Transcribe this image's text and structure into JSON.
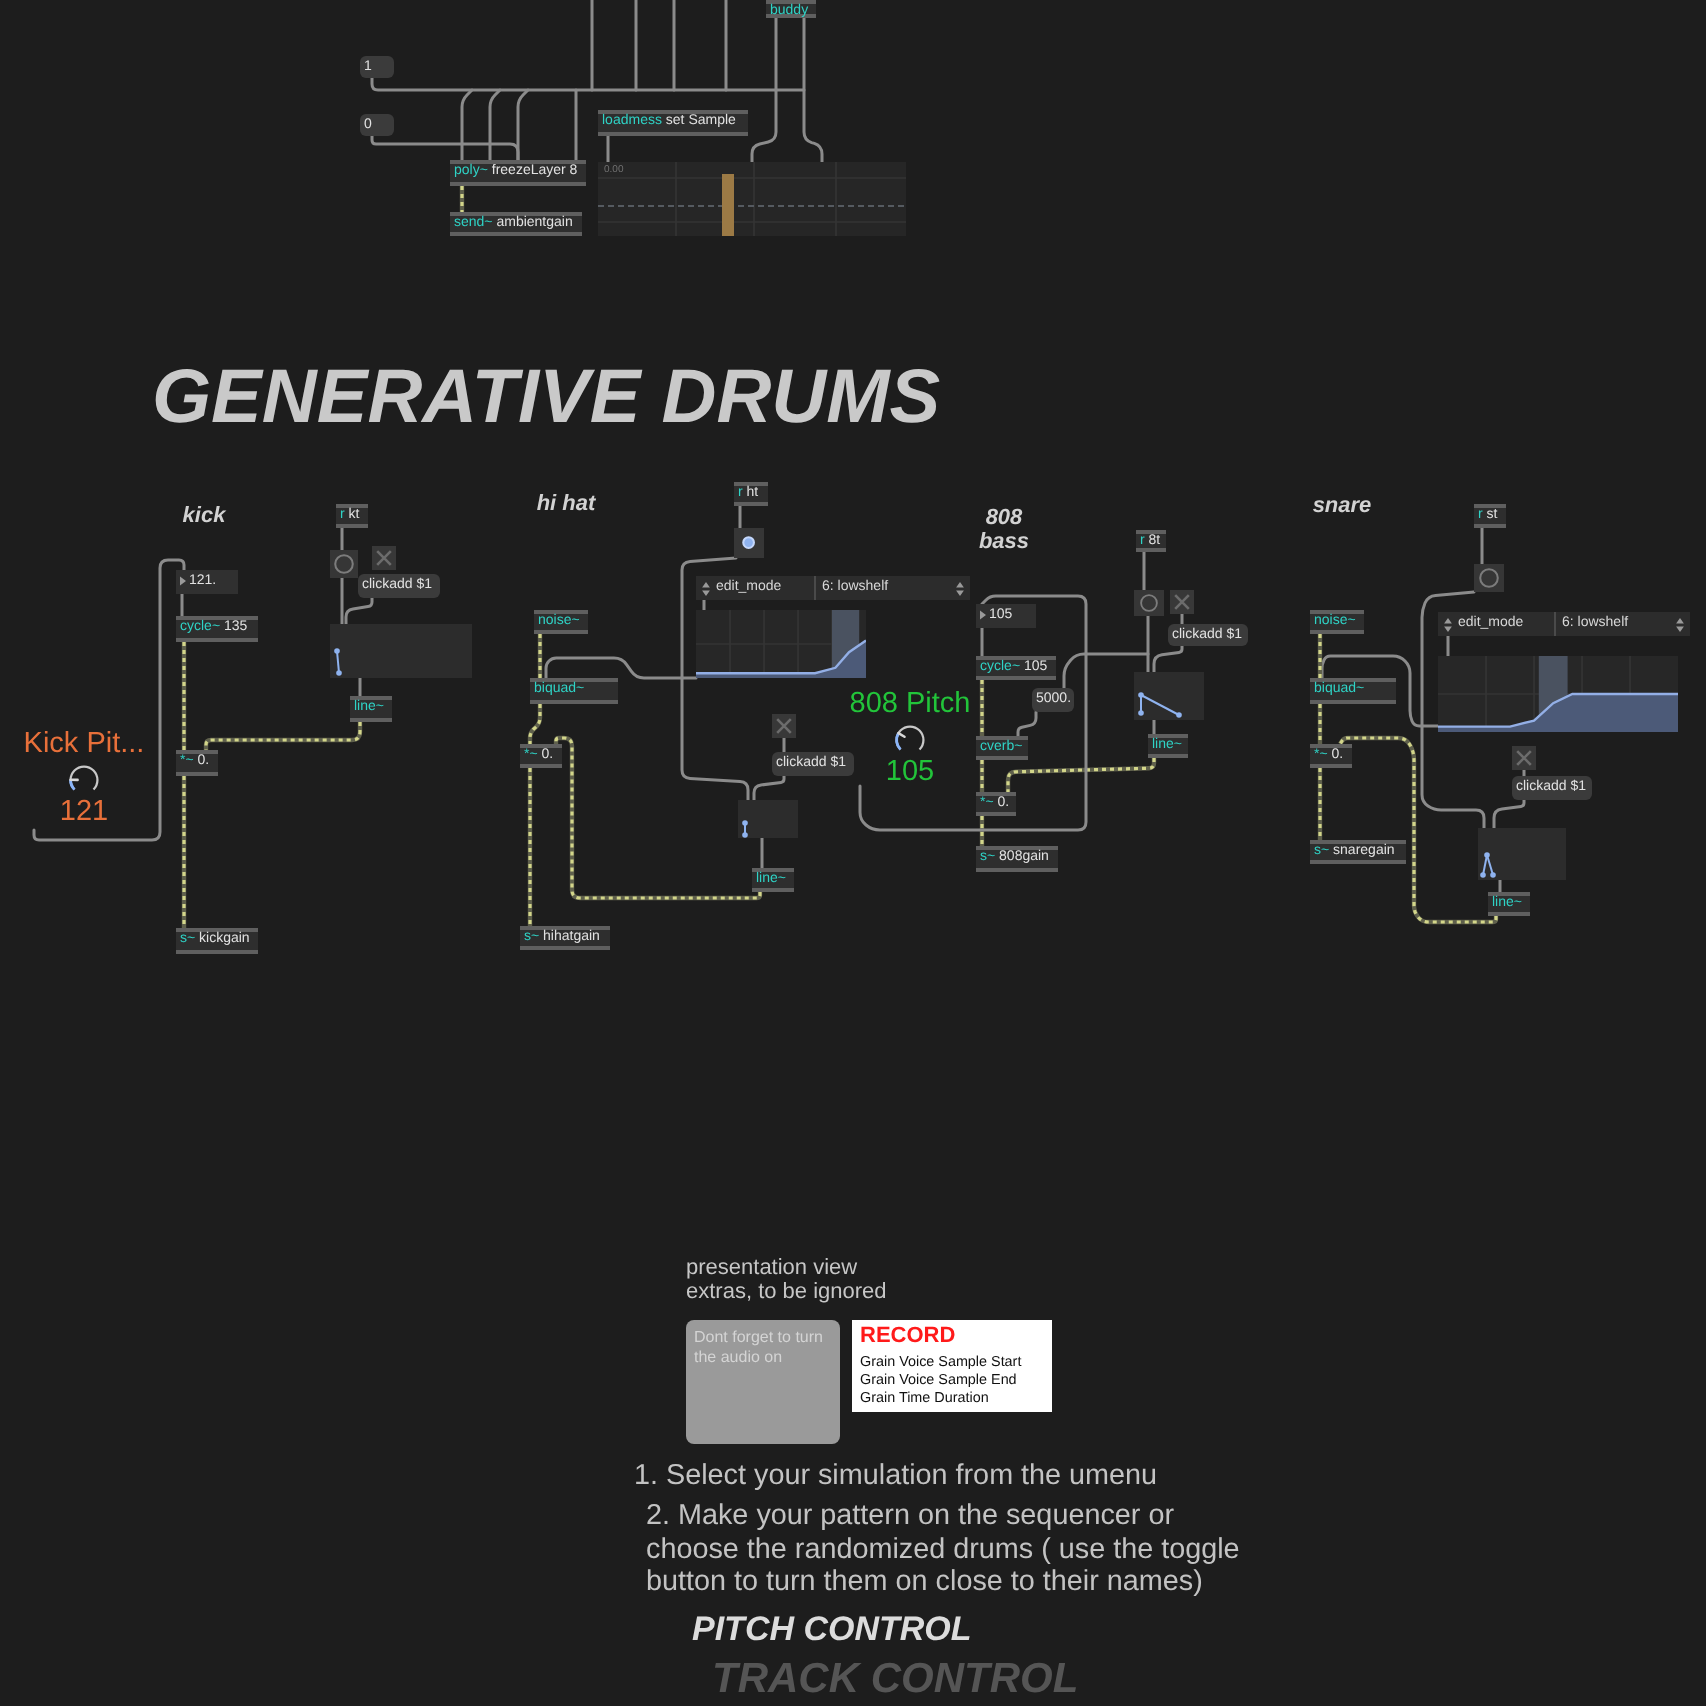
{
  "top_patch": {
    "objects": [
      {
        "kind": "object",
        "name": "buddy"
      },
      {
        "kind": "message",
        "text": "1"
      },
      {
        "kind": "message",
        "text": "0"
      },
      {
        "kind": "object",
        "name": "loadmess",
        "args": "set Sample"
      },
      {
        "kind": "object",
        "name": "poly~",
        "args": "freezeLayer 8"
      },
      {
        "kind": "object",
        "name": "send~",
        "args": "ambientgain"
      },
      {
        "kind": "waveform",
        "start_label": "0.00"
      }
    ]
  },
  "title": "GENERATIVE DRUMS",
  "drum_sections": [
    {
      "label": "kick",
      "objects": [
        {
          "kind": "object",
          "name": "r",
          "args": "kt"
        },
        {
          "kind": "button",
          "on": false
        },
        {
          "kind": "toggle",
          "checked": false
        },
        {
          "kind": "number",
          "text": "121."
        },
        {
          "kind": "message",
          "text": "clickadd $1"
        },
        {
          "kind": "object",
          "name": "cycle~",
          "args": "135"
        },
        {
          "kind": "function"
        },
        {
          "kind": "object",
          "name": "line~"
        },
        {
          "kind": "dial",
          "label": "Kick Pit...",
          "value": "121",
          "level": 0.17,
          "color": "#e8703a"
        },
        {
          "kind": "object",
          "name": "*~",
          "args": "0."
        },
        {
          "kind": "object",
          "name": "s~",
          "args": "kickgain"
        }
      ]
    },
    {
      "label": "hi hat",
      "objects": [
        {
          "kind": "object",
          "name": "r",
          "args": "ht"
        },
        {
          "kind": "button",
          "on": true
        },
        {
          "kind": "umenu",
          "text": "edit_mode"
        },
        {
          "kind": "umenu",
          "text": "6: lowshelf"
        },
        {
          "kind": "object",
          "name": "noise~"
        },
        {
          "kind": "filtergraph"
        },
        {
          "kind": "object",
          "name": "biquad~"
        },
        {
          "kind": "object",
          "name": "*~",
          "args": "0."
        },
        {
          "kind": "toggle",
          "checked": false
        },
        {
          "kind": "message",
          "text": "clickadd $1"
        },
        {
          "kind": "function"
        },
        {
          "kind": "object",
          "name": "line~"
        },
        {
          "kind": "object",
          "name": "s~",
          "args": "hihatgain"
        }
      ]
    },
    {
      "label": "808 bass",
      "objects": [
        {
          "kind": "object",
          "name": "r",
          "args": "8t"
        },
        {
          "kind": "number",
          "text": "105"
        },
        {
          "kind": "button",
          "on": false
        },
        {
          "kind": "toggle",
          "checked": false
        },
        {
          "kind": "message",
          "text": "clickadd $1"
        },
        {
          "kind": "object",
          "name": "cycle~",
          "args": "105"
        },
        {
          "kind": "dial",
          "label": "808 Pitch",
          "value": "105",
          "level": 0.28,
          "color": "#22c43a"
        },
        {
          "kind": "message",
          "text": "5000."
        },
        {
          "kind": "function"
        },
        {
          "kind": "object",
          "name": "cverb~"
        },
        {
          "kind": "object",
          "name": "line~"
        },
        {
          "kind": "object",
          "name": "*~",
          "args": "0."
        },
        {
          "kind": "object",
          "name": "s~",
          "args": "808gain"
        }
      ]
    },
    {
      "label": "snare",
      "objects": [
        {
          "kind": "object",
          "name": "r",
          "args": "st"
        },
        {
          "kind": "button",
          "on": false
        },
        {
          "kind": "object",
          "name": "noise~"
        },
        {
          "kind": "umenu",
          "text": "edit_mode"
        },
        {
          "kind": "umenu",
          "text": "6: lowshelf"
        },
        {
          "kind": "object",
          "name": "biquad~"
        },
        {
          "kind": "filtergraph"
        },
        {
          "kind": "object",
          "name": "*~",
          "args": "0."
        },
        {
          "kind": "toggle",
          "checked": false
        },
        {
          "kind": "message",
          "text": "clickadd $1"
        },
        {
          "kind": "object",
          "name": "s~",
          "args": "snaregain"
        },
        {
          "kind": "function"
        },
        {
          "kind": "object",
          "name": "line~"
        }
      ]
    }
  ],
  "presentation_notes": {
    "comment": "presentation view extras, to be ignored",
    "reminder": "Dont forget to turn the audio on",
    "record_label": "RECORD",
    "grain_labels": [
      "Grain Voice Sample Start",
      "Grain Voice Sample End",
      "Grain Time Duration"
    ],
    "instructions": [
      "1. Select your simulation from the umenu",
      "2. Make your pattern on the sequencer or choose the randomized drums ( use the toggle button to turn them on close to their names)"
    ],
    "headings": [
      "PITCH CONTROL",
      "TRACK CONTROL"
    ]
  }
}
